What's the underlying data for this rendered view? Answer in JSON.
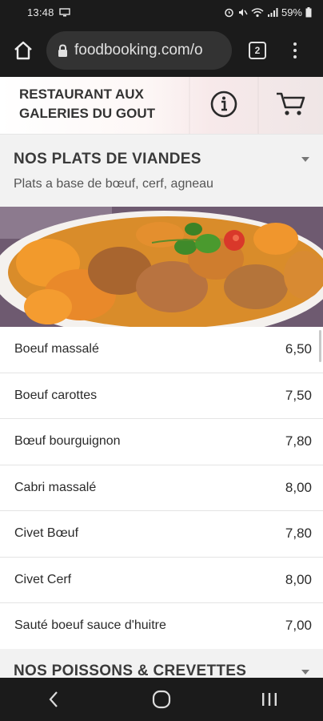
{
  "status_bar": {
    "time": "13:48",
    "battery": "59%"
  },
  "browser": {
    "url": "foodbooking.com/o",
    "tab_count": "2"
  },
  "restaurant": {
    "name": "RESTAURANT AUX GALERIES DU GOUT"
  },
  "category": {
    "title": "NOS PLATS DE VIANDES",
    "description": "Plats a base de bœuf, cerf, agneau"
  },
  "menu_items": [
    {
      "name": "Boeuf massalé",
      "price": "6,50"
    },
    {
      "name": "Boeuf carottes",
      "price": "7,50"
    },
    {
      "name": "Bœuf bourguignon",
      "price": "7,80"
    },
    {
      "name": "Cabri massalé",
      "price": "8,00"
    },
    {
      "name": "Civet Bœuf",
      "price": "7,80"
    },
    {
      "name": "Civet Cerf",
      "price": "8,00"
    },
    {
      "name": "Sauté boeuf sauce d'huitre",
      "price": "7,00"
    }
  ],
  "next_category": {
    "title": "NOS POISSONS & CREVETTES"
  },
  "icons": {
    "home": "home-icon",
    "lock": "lock-icon",
    "info": "info-icon",
    "cart": "cart-icon",
    "back": "back-icon",
    "home_nav": "home-nav-icon",
    "recents": "recents-icon"
  },
  "colors": {
    "system_bar": "#1b1b1b",
    "url_pill": "#333333",
    "category_bg": "#f2f2f2"
  }
}
